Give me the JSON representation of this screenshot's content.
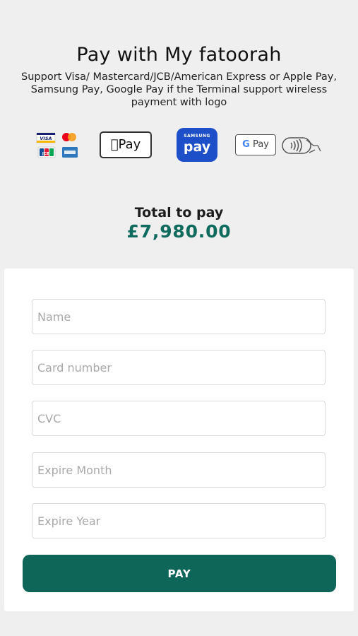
{
  "header": {
    "title": "Pay with My fatoorah",
    "subtitle": "Support Visa/ Mastercard/JCB/American Express or Apple Pay, Samsung Pay, Google Pay if the Terminal support wireless payment with logo"
  },
  "logos": {
    "cards": [
      "VISA",
      "Mastercard",
      "JCB",
      "American Express"
    ],
    "apple_pay": "Pay",
    "samsung_pay_brand": "SAMSUNG",
    "samsung_pay": "pay",
    "google_pay_g": "G",
    "google_pay": "Pay",
    "contactless_icon": "contactless-icon"
  },
  "total": {
    "label": "Total to pay",
    "amount": "£7,980.00"
  },
  "form": {
    "name_placeholder": "Name",
    "card_number_placeholder": "Card number",
    "cvc_placeholder": "CVC",
    "expire_month_placeholder": "Expire Month",
    "expire_year_placeholder": "Expire Year",
    "pay_label": "PAY"
  },
  "colors": {
    "accent": "#0d6658",
    "amount": "#0f6b5d",
    "background": "#eeefee",
    "samsung_blue": "#1d4fc9"
  }
}
